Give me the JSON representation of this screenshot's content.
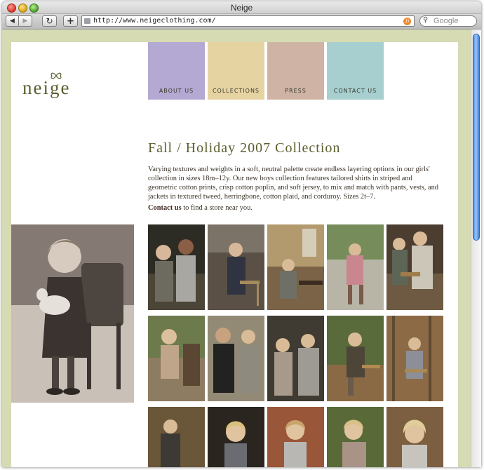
{
  "window": {
    "title": "Neige"
  },
  "toolbar": {
    "back": "◀",
    "forward": "▶",
    "reload": "↻",
    "add": "+",
    "url": "http://www.neigeclothing.com/",
    "search_placeholder": "Google"
  },
  "site": {
    "logo": "neige",
    "nav": [
      {
        "label": "ABOUT US",
        "color": "#b4a9d3"
      },
      {
        "label": "COLLECTIONS",
        "color": "#e6d3a2"
      },
      {
        "label": "PRESS",
        "color": "#cfb4a6"
      },
      {
        "label": "CONTACT US",
        "color": "#a7cfcf"
      }
    ],
    "heading": "Fall / Holiday 2007 Collection",
    "intro": "Varying textures and weights in a soft, neutral palette create endless layering options in our girls' collection in sizes 18m–12y. Our new boys collection features tailored shirts in striped and geometric cotton prints, crisp cotton poplin, and soft jersey, to mix and match with pants, vests, and jackets in textured tweed, herringbone, cotton plaid, and corduroy. Sizes 2t–7.",
    "contact_link": "Contact us",
    "contact_rest": " to find a store near you."
  },
  "colors": {
    "background": "#d6dbb3",
    "heading": "#5d5f2f",
    "logo": "#5b5f2e"
  }
}
